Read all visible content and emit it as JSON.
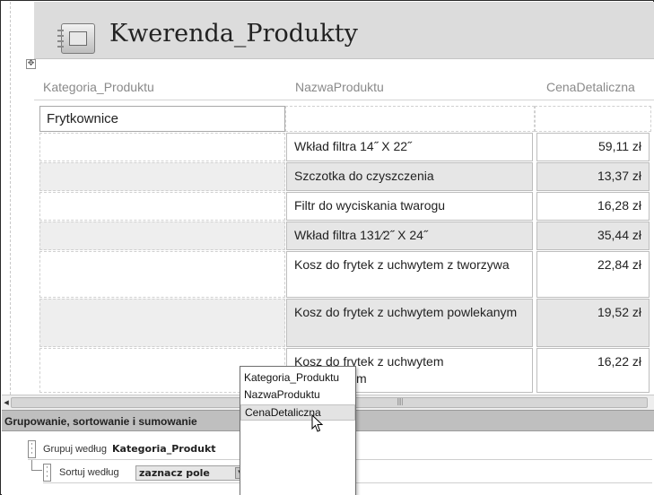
{
  "report": {
    "title": "Kwerenda_Produkty",
    "columns": [
      "Kategoria_Produktu",
      "NazwaProduktu",
      "CenaDetaliczna"
    ],
    "group_value": "Frytkownice",
    "rows": [
      {
        "name": "Wkład filtra 14˝ X 22˝",
        "price": "59,11 zł"
      },
      {
        "name": "Szczotka do czyszczenia",
        "price": "13,37 zł"
      },
      {
        "name": "Filtr do wyciskania twarogu",
        "price": "16,28 zł"
      },
      {
        "name": "Wkład filtra 131⁄2˝ X 24˝",
        "price": "35,44 zł"
      },
      {
        "name": "Kosz do frytek z uchwytem z tworzywa",
        "price": "22,84 zł"
      },
      {
        "name": "Kosz do frytek z uchwytem powlekanym",
        "price": "19,52 zł"
      },
      {
        "name": "Kosz do frytek z uchwytem",
        "name_tail": "ym",
        "price": "16,22 zł"
      }
    ]
  },
  "grouping_pane": {
    "title": "Grupowanie, sortowanie i sumowanie",
    "group_by_label": "Grupuj według",
    "group_by_field": "Kategoria_Produkt",
    "sort_by_label": "Sortuj według",
    "sort_field_placeholder": "zaznacz pole"
  },
  "field_list": {
    "options": [
      "Kategoria_Produktu",
      "NazwaProduktu",
      "CenaDetaliczna"
    ],
    "hovered": "CenaDetaliczna"
  },
  "icons": {
    "report": "report-icon",
    "move": "move-handle-icon",
    "scroll_left": "scroll-left-arrow-icon",
    "dropdown": "dropdown-arrow-icon",
    "cursor": "mouse-pointer-icon",
    "row_handle": "drag-handle-icon"
  }
}
